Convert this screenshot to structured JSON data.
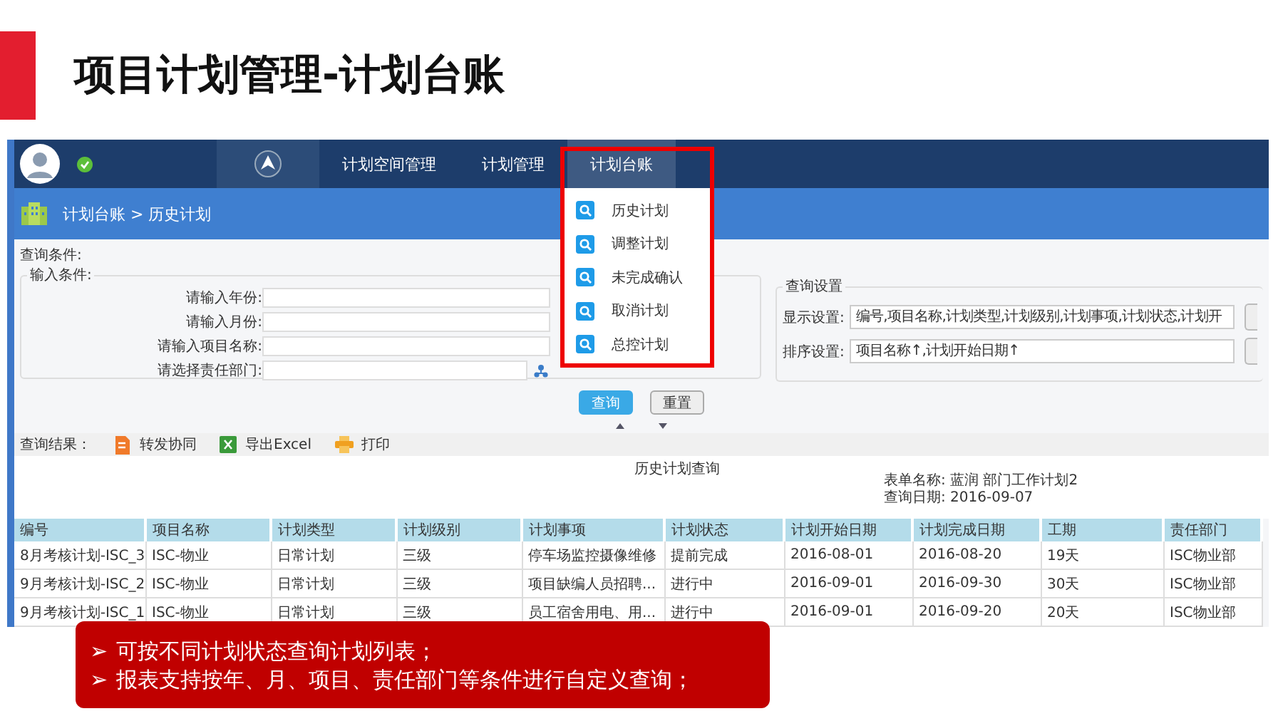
{
  "slide": {
    "title": "项目计划管理-计划台账"
  },
  "app": {
    "nav": {
      "tabs": [
        {
          "label": "计划空间管理",
          "selected": false
        },
        {
          "label": "计划管理",
          "selected": false
        },
        {
          "label": "计划台账",
          "selected": true
        }
      ]
    },
    "menu": {
      "items": [
        "历史计划",
        "调整计划",
        "未完成确认",
        "取消计划",
        "总控计划"
      ]
    },
    "breadcrumb": "计划台账 > 历史计划",
    "query": {
      "title": "查询条件:",
      "input_group": {
        "legend": "输入条件:",
        "fields": [
          {
            "label": "请输入年份:",
            "kind": "text"
          },
          {
            "label": "请输入月份:",
            "kind": "text"
          },
          {
            "label": "请输入项目名称:",
            "kind": "text"
          },
          {
            "label": "请选择责任部门:",
            "kind": "picker"
          }
        ]
      },
      "settings": {
        "legend": "查询设置",
        "fields": [
          {
            "label": "显示设置:",
            "value": "编号,项目名称,计划类型,计划级别,计划事项,计划状态,计划开"
          },
          {
            "label": "排序设置:",
            "value": "项目名称↑,计划开始日期↑"
          }
        ]
      },
      "buttons": [
        {
          "label": "查询",
          "kind": "primary"
        },
        {
          "label": "重置",
          "kind": "default"
        }
      ]
    },
    "results": {
      "label": "查询结果：",
      "actions": [
        {
          "label": "转发协同",
          "kind": "forward"
        },
        {
          "label": "导出Excel",
          "kind": "excel"
        },
        {
          "label": "打印",
          "kind": "print"
        }
      ],
      "report_title": "历史计划查询",
      "form_name": "表单名称: 蓝润 部门工作计划2",
      "query_date": "查询日期: 2016-09-07"
    },
    "table": {
      "columns": [
        "编号",
        "项目名称",
        "计划类型",
        "计划级别",
        "计划事项",
        "计划状态",
        "计划开始日期",
        "计划完成日期",
        "工期",
        "责任部门"
      ],
      "rows": [
        [
          "8月考核计划-ISC_3",
          "ISC-物业",
          "日常计划",
          "三级",
          "停车场监控摄像维修",
          "提前完成",
          "2016-08-01",
          "2016-08-20",
          "19天",
          "ISC物业部"
        ],
        [
          "9月考核计划-ISC_2",
          "ISC-物业",
          "日常计划",
          "三级",
          "项目缺编人员招聘...",
          "进行中",
          "2016-09-01",
          "2016-09-30",
          "30天",
          "ISC物业部"
        ],
        [
          "9月考核计划-ISC_1",
          "ISC-物业",
          "日常计划",
          "三级",
          "员工宿舍用电、用...",
          "进行中",
          "2016-09-01",
          "2016-09-20",
          "20天",
          "ISC物业部"
        ]
      ]
    }
  },
  "callout": {
    "points": [
      {
        "bullet": "➢",
        "text": "可按不同计划状态查询计划列表；"
      },
      {
        "bullet": "➢",
        "text": "报表支持按年、月、项目、责任部门等条件进行自定义查询；"
      }
    ]
  }
}
